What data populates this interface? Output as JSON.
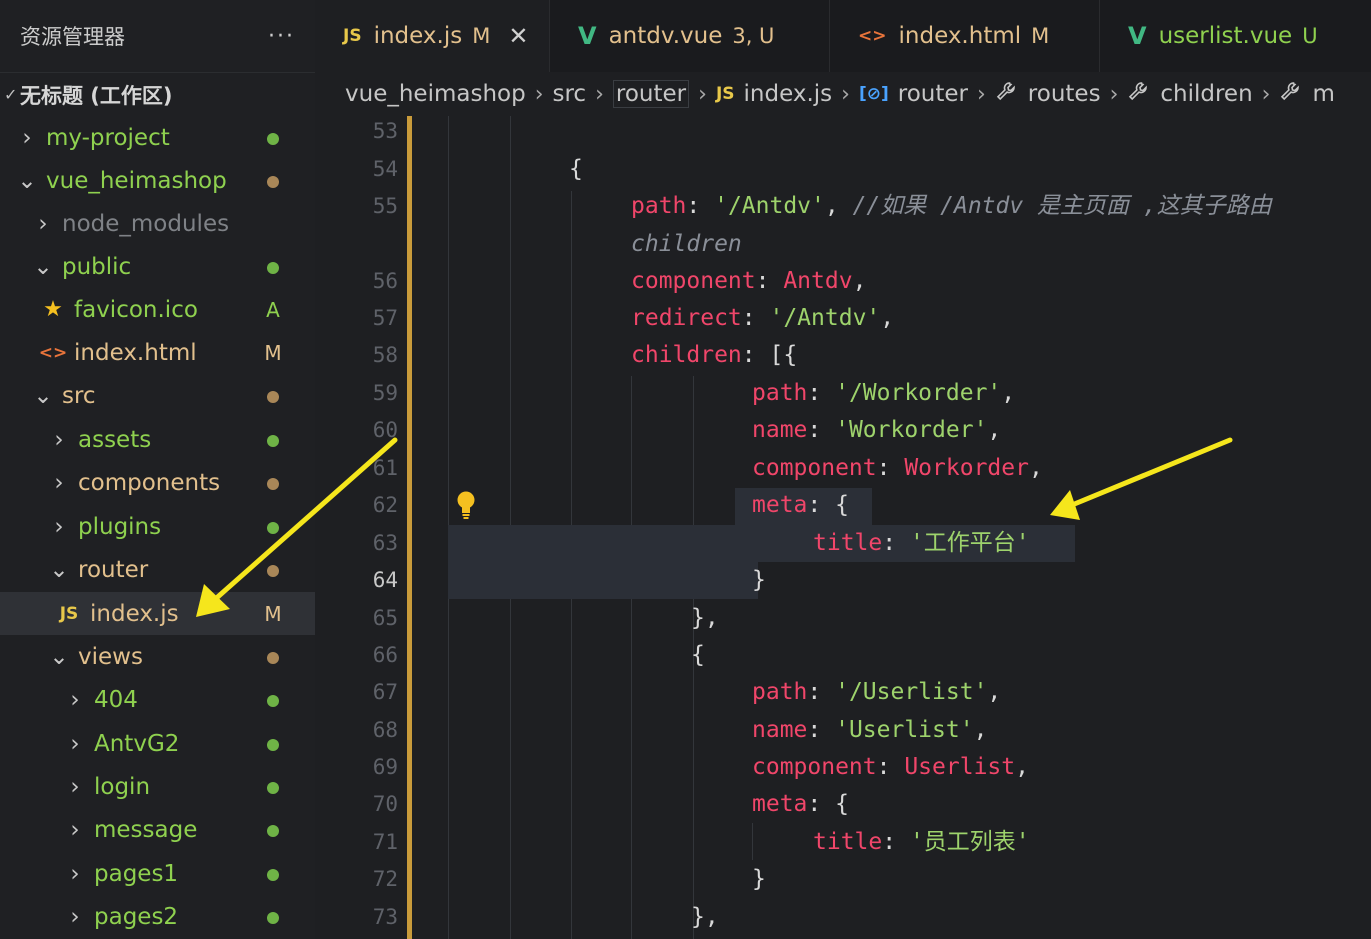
{
  "sidebar": {
    "title": "资源管理器",
    "more": "···",
    "workspace": "无标题 (工作区)",
    "items": [
      {
        "label": "my-project",
        "status": "",
        "color": "#8fd14f"
      },
      {
        "label": "vue_heimashop",
        "status": "",
        "color": "#8fd14f"
      },
      {
        "label": "node_modules",
        "status": "",
        "color": "#7f8287"
      },
      {
        "label": "public",
        "status": "",
        "color": "#8fd14f"
      },
      {
        "label": "favicon.ico",
        "status": "A",
        "color": "#8fd14f"
      },
      {
        "label": "index.html",
        "status": "M",
        "color": "#e2c08d"
      },
      {
        "label": "src",
        "status": "",
        "color": "#e2c08d"
      },
      {
        "label": "assets",
        "status": "",
        "color": "#8fd14f"
      },
      {
        "label": "components",
        "status": "",
        "color": "#e2c08d"
      },
      {
        "label": "plugins",
        "status": "",
        "color": "#8fd14f"
      },
      {
        "label": "router",
        "status": "",
        "color": "#e2c08d"
      },
      {
        "label": "index.js",
        "status": "M",
        "color": "#e2c08d"
      },
      {
        "label": "views",
        "status": "",
        "color": "#e2c08d"
      },
      {
        "label": "404",
        "status": "",
        "color": "#8fd14f"
      },
      {
        "label": "AntvG2",
        "status": "",
        "color": "#8fd14f"
      },
      {
        "label": "login",
        "status": "",
        "color": "#8fd14f"
      },
      {
        "label": "message",
        "status": "",
        "color": "#8fd14f"
      },
      {
        "label": "pages1",
        "status": "",
        "color": "#8fd14f"
      },
      {
        "label": "pages2",
        "status": "",
        "color": "#8fd14f"
      }
    ]
  },
  "tabs": [
    {
      "icon": "JS",
      "label": "index.js",
      "status": "M",
      "close": "✕"
    },
    {
      "icon": "V",
      "label": "antdv.vue",
      "status": "3, U"
    },
    {
      "icon": "<>",
      "label": "index.html",
      "status": "M"
    },
    {
      "icon": "V",
      "label": "userlist.vue",
      "status": "U"
    }
  ],
  "breadcrumb": {
    "project": "vue_heimashop",
    "src": "src",
    "router_folder": "router",
    "file_icon": "JS",
    "file": "index.js",
    "symbol_icon": "[⊘]",
    "symbol": "router",
    "routes": "routes",
    "children": "children",
    "more": "m"
  },
  "editor": {
    "current_line": "64",
    "line_numbers": [
      "53",
      "54",
      "55",
      "",
      "56",
      "57",
      "58",
      "59",
      "60",
      "61",
      "62",
      "63",
      "64",
      "65",
      "66",
      "67",
      "68",
      "69",
      "70",
      "71",
      "72",
      "73"
    ],
    "code": {
      "l54_brace": "{",
      "l55_key": "path",
      "l55_colon": ": ",
      "l55_val": "'/Antdv'",
      "l55_comma": ", ",
      "l55_comment": "//如果 /Antdv 是主页面 ,这其子路由",
      "l55b_comment": "children",
      "l56_key": "component",
      "l56_val": "Antdv",
      "l57_key": "redirect",
      "l57_val": "'/Antdv'",
      "l58_key": "children",
      "l58_rest": ": [{",
      "l59_key": "path",
      "l59_val": "'/Workorder'",
      "l60_key": "name",
      "l60_val": "'Workorder'",
      "l61_key": "component",
      "l61_val": "Workorder",
      "l62_key": "meta",
      "l62_rest": ": {",
      "l63_key": "title",
      "l63_val": "'工作平台'",
      "l64": "}",
      "l65": "},",
      "l66": "{",
      "l67_key": "path",
      "l67_val": "'/Userlist'",
      "l68_key": "name",
      "l68_val": "'Userlist'",
      "l69_key": "component",
      "l69_val": "Userlist",
      "l70_key": "meta",
      "l70_rest": ": {",
      "l71_key": "title",
      "l71_val": "'员工列表'",
      "l72": "}",
      "l73": "},"
    }
  },
  "colors": {
    "accent_yellow": "#f5e61c",
    "modified": "#e2c08d",
    "untracked": "#8fd14f",
    "keyword": "#f0466a",
    "string": "#9ed36c"
  }
}
